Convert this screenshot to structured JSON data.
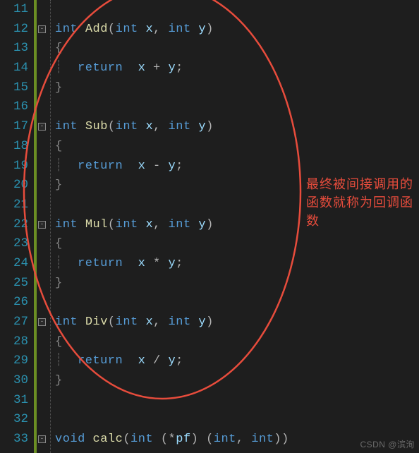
{
  "lines": {
    "start": 11,
    "end": 33,
    "numbers": [
      "11",
      "12",
      "13",
      "14",
      "15",
      "16",
      "17",
      "18",
      "19",
      "20",
      "21",
      "22",
      "23",
      "24",
      "25",
      "26",
      "27",
      "28",
      "29",
      "30",
      "31",
      "32",
      "33"
    ]
  },
  "code": {
    "kw_int": "int",
    "kw_void": "void",
    "kw_return": "return",
    "fn_add": "Add",
    "fn_sub": "Sub",
    "fn_mul": "Mul",
    "fn_div": "Div",
    "fn_calc": "calc",
    "var_x": "x",
    "var_y": "y",
    "var_pf": "pf",
    "lparen": "(",
    "rparen": ")",
    "comma": ",",
    "lbrace": "{",
    "rbrace": "}",
    "op_plus": "+",
    "op_minus": "-",
    "op_mul": "*",
    "op_div": "/",
    "op_star": "*",
    "semi": ";"
  },
  "fold": {
    "symbol": "-"
  },
  "annotation": {
    "text_l1": "最终被间接调用的",
    "text_l2": "函数就称为回调函",
    "text_l3": "数"
  },
  "watermark": "CSDN @滨洵"
}
